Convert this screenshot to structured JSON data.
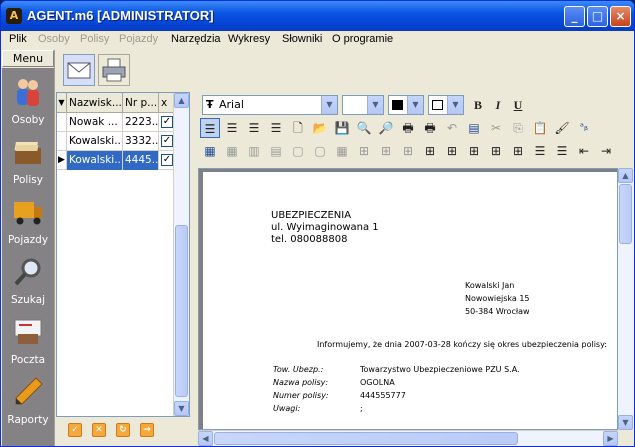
{
  "window": {
    "title": "AGENT.m6 [ADMINISTRATOR]",
    "minimize": "_",
    "maximize": "□",
    "close": "×"
  },
  "menu": [
    {
      "label": "Plik",
      "enabled": true
    },
    {
      "label": "Osoby",
      "enabled": false
    },
    {
      "label": "Polisy",
      "enabled": false
    },
    {
      "label": "Pojazdy",
      "enabled": false
    },
    {
      "label": "Narzędzia",
      "enabled": true
    },
    {
      "label": "Wykresy",
      "enabled": true
    },
    {
      "label": "Słowniki",
      "enabled": true
    },
    {
      "label": "O programie",
      "enabled": true
    }
  ],
  "sidebar": {
    "header": "Menu",
    "items": [
      {
        "label": "Osoby",
        "icon": "people-icon"
      },
      {
        "label": "Polisy",
        "icon": "policy-files-icon"
      },
      {
        "label": "Pojazdy",
        "icon": "truck-icon"
      },
      {
        "label": "Szukaj",
        "icon": "magnifier-icon"
      },
      {
        "label": "Poczta",
        "icon": "mail-icon"
      },
      {
        "label": "Raporty",
        "icon": "pencil-icon"
      }
    ]
  },
  "grid": {
    "columns": [
      "Nazwisk...",
      "Nr p...",
      "x"
    ],
    "rows": [
      {
        "name": "Nowak ...",
        "nr": "2223...",
        "checked": "✓",
        "selected": false
      },
      {
        "name": "Kowalski...",
        "nr": "3332...",
        "checked": "✓",
        "selected": false
      },
      {
        "name": "Kowalski...",
        "nr": "4445...",
        "checked": "✓",
        "selected": true
      }
    ]
  },
  "editor": {
    "font": "Arial",
    "font_icon": "Ŧ",
    "size": "",
    "bold": "B",
    "italic": "I",
    "underline": "U"
  },
  "document": {
    "sender": [
      "UBEZPIECZENIA",
      "ul. Wyimaginowana 1",
      "tel. 080088808"
    ],
    "recipient": [
      "Kowalski Jan",
      "Nowowiejska 15",
      "50-384 Wrocław"
    ],
    "info": "Informujemy, że dnia 2007-03-28 kończy się okres ubezpieczenia polisy:",
    "details": [
      {
        "label": "Tow. Ubezp.:",
        "value": "Towarzystwo Ubezpieczeniowe PZU S.A."
      },
      {
        "label": "Nazwa polisy:",
        "value": "OGOLNA"
      },
      {
        "label": "Numer polisy:",
        "value": "444555777"
      },
      {
        "label": "Uwagi:",
        "value": ";"
      }
    ]
  }
}
